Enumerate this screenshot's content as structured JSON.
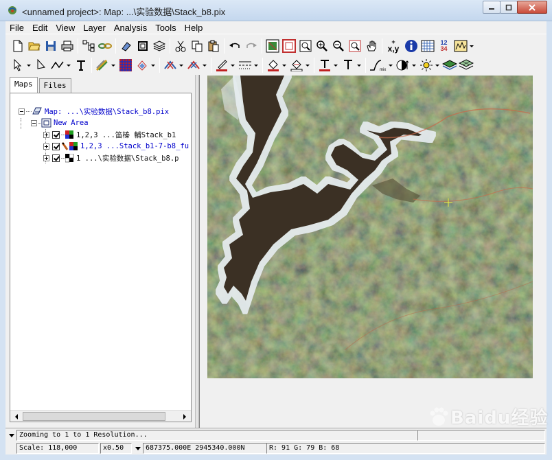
{
  "window": {
    "title": "<unnamed project>: Map: ...\\实验数据\\Stack_b8.pix",
    "minimize_icon": "minimize-icon",
    "maximize_icon": "maximize-icon",
    "close_icon": "close-icon"
  },
  "menu": [
    "File",
    "Edit",
    "View",
    "Layer",
    "Analysis",
    "Tools",
    "Help"
  ],
  "toolbar": {
    "xy_label": "x,y",
    "numbers_label_top": "12",
    "numbers_label_bottom": "34"
  },
  "tabs": [
    {
      "label": "Maps",
      "active": true
    },
    {
      "label": "Files",
      "active": false
    }
  ],
  "tree": {
    "map_label": "Map: ...\\实验数据\\Stack_b8.pix",
    "area_label": "New Area",
    "layers": [
      {
        "label": "1,2,3 ...笛榛  輔Stack_b1",
        "color": "black",
        "icon": "rgb-layer-icon",
        "checked": true
      },
      {
        "label": "1,2,3 ...Stack_b1-7-b8_fu",
        "color": "blue",
        "icon": "rgb-layer-icon",
        "checked": true
      },
      {
        "label": "1 ...\\实验数据\\Stack_b8.p",
        "color": "black",
        "icon": "grey-layer-icon",
        "checked": true
      }
    ]
  },
  "status": {
    "message": "Zooming to 1 to 1 Resolution...",
    "scale": "Scale: 118,000",
    "zoom": "x0.50",
    "coords": "687375.000E 2945340.000N",
    "rgb": "R: 91 G: 79 B: 68"
  },
  "watermark": {
    "text": "Baidu经验"
  },
  "colors": {
    "water": "#3b3024",
    "forest": "#2c3a24",
    "shore": "#e8eef2"
  }
}
